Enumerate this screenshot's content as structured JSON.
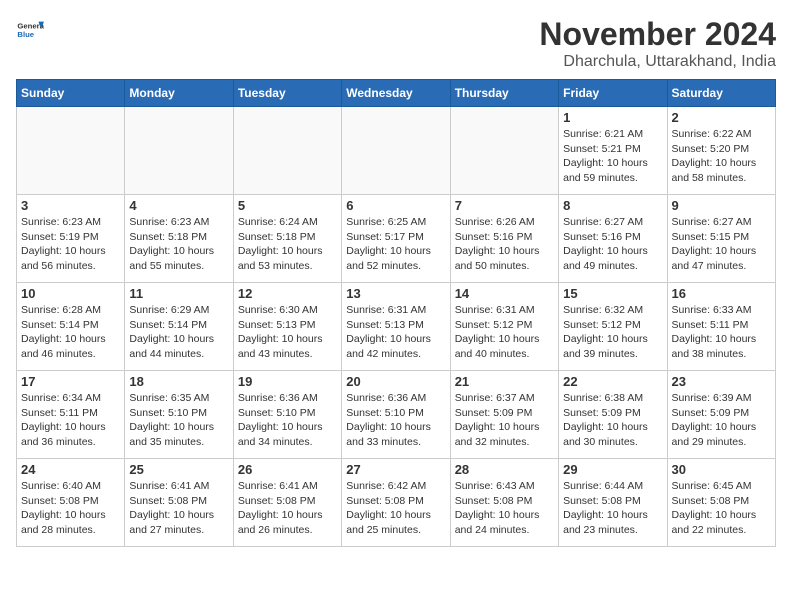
{
  "header": {
    "logo_general": "General",
    "logo_blue": "Blue",
    "month_year": "November 2024",
    "location": "Dharchula, Uttarakhand, India"
  },
  "weekdays": [
    "Sunday",
    "Monday",
    "Tuesday",
    "Wednesday",
    "Thursday",
    "Friday",
    "Saturday"
  ],
  "weeks": [
    [
      {
        "day": "",
        "info": ""
      },
      {
        "day": "",
        "info": ""
      },
      {
        "day": "",
        "info": ""
      },
      {
        "day": "",
        "info": ""
      },
      {
        "day": "",
        "info": ""
      },
      {
        "day": "1",
        "info": "Sunrise: 6:21 AM\nSunset: 5:21 PM\nDaylight: 10 hours and 59 minutes."
      },
      {
        "day": "2",
        "info": "Sunrise: 6:22 AM\nSunset: 5:20 PM\nDaylight: 10 hours and 58 minutes."
      }
    ],
    [
      {
        "day": "3",
        "info": "Sunrise: 6:23 AM\nSunset: 5:19 PM\nDaylight: 10 hours and 56 minutes."
      },
      {
        "day": "4",
        "info": "Sunrise: 6:23 AM\nSunset: 5:18 PM\nDaylight: 10 hours and 55 minutes."
      },
      {
        "day": "5",
        "info": "Sunrise: 6:24 AM\nSunset: 5:18 PM\nDaylight: 10 hours and 53 minutes."
      },
      {
        "day": "6",
        "info": "Sunrise: 6:25 AM\nSunset: 5:17 PM\nDaylight: 10 hours and 52 minutes."
      },
      {
        "day": "7",
        "info": "Sunrise: 6:26 AM\nSunset: 5:16 PM\nDaylight: 10 hours and 50 minutes."
      },
      {
        "day": "8",
        "info": "Sunrise: 6:27 AM\nSunset: 5:16 PM\nDaylight: 10 hours and 49 minutes."
      },
      {
        "day": "9",
        "info": "Sunrise: 6:27 AM\nSunset: 5:15 PM\nDaylight: 10 hours and 47 minutes."
      }
    ],
    [
      {
        "day": "10",
        "info": "Sunrise: 6:28 AM\nSunset: 5:14 PM\nDaylight: 10 hours and 46 minutes."
      },
      {
        "day": "11",
        "info": "Sunrise: 6:29 AM\nSunset: 5:14 PM\nDaylight: 10 hours and 44 minutes."
      },
      {
        "day": "12",
        "info": "Sunrise: 6:30 AM\nSunset: 5:13 PM\nDaylight: 10 hours and 43 minutes."
      },
      {
        "day": "13",
        "info": "Sunrise: 6:31 AM\nSunset: 5:13 PM\nDaylight: 10 hours and 42 minutes."
      },
      {
        "day": "14",
        "info": "Sunrise: 6:31 AM\nSunset: 5:12 PM\nDaylight: 10 hours and 40 minutes."
      },
      {
        "day": "15",
        "info": "Sunrise: 6:32 AM\nSunset: 5:12 PM\nDaylight: 10 hours and 39 minutes."
      },
      {
        "day": "16",
        "info": "Sunrise: 6:33 AM\nSunset: 5:11 PM\nDaylight: 10 hours and 38 minutes."
      }
    ],
    [
      {
        "day": "17",
        "info": "Sunrise: 6:34 AM\nSunset: 5:11 PM\nDaylight: 10 hours and 36 minutes."
      },
      {
        "day": "18",
        "info": "Sunrise: 6:35 AM\nSunset: 5:10 PM\nDaylight: 10 hours and 35 minutes."
      },
      {
        "day": "19",
        "info": "Sunrise: 6:36 AM\nSunset: 5:10 PM\nDaylight: 10 hours and 34 minutes."
      },
      {
        "day": "20",
        "info": "Sunrise: 6:36 AM\nSunset: 5:10 PM\nDaylight: 10 hours and 33 minutes."
      },
      {
        "day": "21",
        "info": "Sunrise: 6:37 AM\nSunset: 5:09 PM\nDaylight: 10 hours and 32 minutes."
      },
      {
        "day": "22",
        "info": "Sunrise: 6:38 AM\nSunset: 5:09 PM\nDaylight: 10 hours and 30 minutes."
      },
      {
        "day": "23",
        "info": "Sunrise: 6:39 AM\nSunset: 5:09 PM\nDaylight: 10 hours and 29 minutes."
      }
    ],
    [
      {
        "day": "24",
        "info": "Sunrise: 6:40 AM\nSunset: 5:08 PM\nDaylight: 10 hours and 28 minutes."
      },
      {
        "day": "25",
        "info": "Sunrise: 6:41 AM\nSunset: 5:08 PM\nDaylight: 10 hours and 27 minutes."
      },
      {
        "day": "26",
        "info": "Sunrise: 6:41 AM\nSunset: 5:08 PM\nDaylight: 10 hours and 26 minutes."
      },
      {
        "day": "27",
        "info": "Sunrise: 6:42 AM\nSunset: 5:08 PM\nDaylight: 10 hours and 25 minutes."
      },
      {
        "day": "28",
        "info": "Sunrise: 6:43 AM\nSunset: 5:08 PM\nDaylight: 10 hours and 24 minutes."
      },
      {
        "day": "29",
        "info": "Sunrise: 6:44 AM\nSunset: 5:08 PM\nDaylight: 10 hours and 23 minutes."
      },
      {
        "day": "30",
        "info": "Sunrise: 6:45 AM\nSunset: 5:08 PM\nDaylight: 10 hours and 22 minutes."
      }
    ]
  ]
}
